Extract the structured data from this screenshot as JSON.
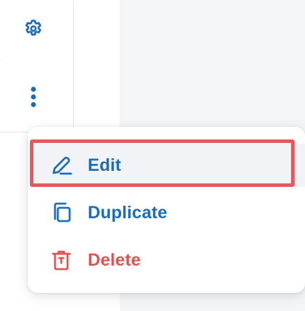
{
  "toolbar": {
    "settings_icon": "gear-icon",
    "more_icon": "vertical-ellipsis-icon"
  },
  "menu": {
    "items": [
      {
        "label": "Edit",
        "icon": "pencil-icon",
        "color": "#1a6dbb",
        "selected": true
      },
      {
        "label": "Duplicate",
        "icon": "duplicate-icon",
        "color": "#1a6dbb"
      },
      {
        "label": "Delete",
        "icon": "trash-icon",
        "color": "#e0524f"
      }
    ]
  },
  "colors": {
    "accent": "#1a6dbb",
    "danger": "#e0524f",
    "highlight": "#e8585a"
  }
}
